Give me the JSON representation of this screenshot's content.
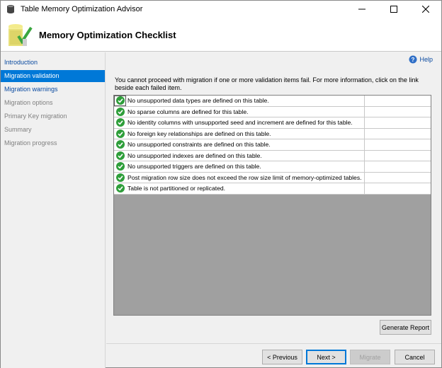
{
  "window": {
    "title": "Table Memory Optimization Advisor"
  },
  "header": {
    "title": "Memory Optimization Checklist"
  },
  "sidebar": {
    "items": [
      {
        "label": "Introduction",
        "state": "link"
      },
      {
        "label": "Migration validation",
        "state": "active"
      },
      {
        "label": "Migration warnings",
        "state": "link"
      },
      {
        "label": "Migration options",
        "state": "disabled"
      },
      {
        "label": "Primary Key migration",
        "state": "disabled"
      },
      {
        "label": "Summary",
        "state": "disabled"
      },
      {
        "label": "Migration progress",
        "state": "disabled"
      }
    ]
  },
  "main": {
    "help_label": "Help",
    "instructions": "You cannot proceed with migration if one or more validation items fail. For more information, click on the link beside each failed item.",
    "checklist": [
      {
        "status": "passed",
        "text": "No unsupported data types are defined on this table.",
        "link": ""
      },
      {
        "status": "passed",
        "text": "No sparse columns are defined for this table.",
        "link": ""
      },
      {
        "status": "passed",
        "text": "No identity columns with unsupported seed and increment are defined for this table.",
        "link": ""
      },
      {
        "status": "passed",
        "text": "No foreign key relationships are defined on this table.",
        "link": ""
      },
      {
        "status": "passed",
        "text": "No unsupported constraints are defined on this table.",
        "link": ""
      },
      {
        "status": "passed",
        "text": "No unsupported indexes are defined on this table.",
        "link": ""
      },
      {
        "status": "passed",
        "text": "No unsupported triggers are defined on this table.",
        "link": ""
      },
      {
        "status": "passed",
        "text": "Post migration row size does not exceed the row size limit of memory-optimized tables.",
        "link": ""
      },
      {
        "status": "passed",
        "text": "Table is not partitioned or replicated.",
        "link": ""
      }
    ],
    "generate_report_label": "Generate Report"
  },
  "footer": {
    "previous_label": "< Previous",
    "next_label": "Next >",
    "migrate_label": "Migrate",
    "cancel_label": "Cancel"
  },
  "colors": {
    "accent": "#0078d7",
    "link": "#0a4aa0",
    "check_green": "#2e9e3a"
  }
}
